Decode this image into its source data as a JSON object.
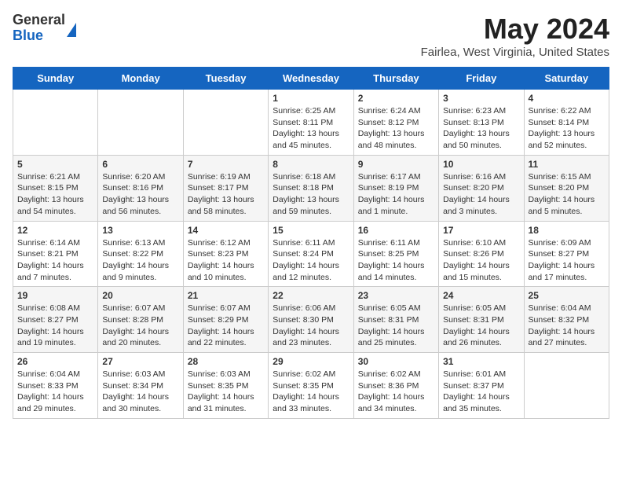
{
  "header": {
    "logo_general": "General",
    "logo_blue": "Blue",
    "title": "May 2024",
    "location": "Fairlea, West Virginia, United States"
  },
  "days_of_week": [
    "Sunday",
    "Monday",
    "Tuesday",
    "Wednesday",
    "Thursday",
    "Friday",
    "Saturday"
  ],
  "weeks": [
    [
      {
        "day": null
      },
      {
        "day": null
      },
      {
        "day": null
      },
      {
        "day": "1",
        "sunrise": "6:25 AM",
        "sunset": "8:11 PM",
        "daylight": "13 hours and 45 minutes."
      },
      {
        "day": "2",
        "sunrise": "6:24 AM",
        "sunset": "8:12 PM",
        "daylight": "13 hours and 48 minutes."
      },
      {
        "day": "3",
        "sunrise": "6:23 AM",
        "sunset": "8:13 PM",
        "daylight": "13 hours and 50 minutes."
      },
      {
        "day": "4",
        "sunrise": "6:22 AM",
        "sunset": "8:14 PM",
        "daylight": "13 hours and 52 minutes."
      }
    ],
    [
      {
        "day": "5",
        "sunrise": "6:21 AM",
        "sunset": "8:15 PM",
        "daylight": "13 hours and 54 minutes."
      },
      {
        "day": "6",
        "sunrise": "6:20 AM",
        "sunset": "8:16 PM",
        "daylight": "13 hours and 56 minutes."
      },
      {
        "day": "7",
        "sunrise": "6:19 AM",
        "sunset": "8:17 PM",
        "daylight": "13 hours and 58 minutes."
      },
      {
        "day": "8",
        "sunrise": "6:18 AM",
        "sunset": "8:18 PM",
        "daylight": "13 hours and 59 minutes."
      },
      {
        "day": "9",
        "sunrise": "6:17 AM",
        "sunset": "8:19 PM",
        "daylight": "14 hours and 1 minute."
      },
      {
        "day": "10",
        "sunrise": "6:16 AM",
        "sunset": "8:20 PM",
        "daylight": "14 hours and 3 minutes."
      },
      {
        "day": "11",
        "sunrise": "6:15 AM",
        "sunset": "8:20 PM",
        "daylight": "14 hours and 5 minutes."
      }
    ],
    [
      {
        "day": "12",
        "sunrise": "6:14 AM",
        "sunset": "8:21 PM",
        "daylight": "14 hours and 7 minutes."
      },
      {
        "day": "13",
        "sunrise": "6:13 AM",
        "sunset": "8:22 PM",
        "daylight": "14 hours and 9 minutes."
      },
      {
        "day": "14",
        "sunrise": "6:12 AM",
        "sunset": "8:23 PM",
        "daylight": "14 hours and 10 minutes."
      },
      {
        "day": "15",
        "sunrise": "6:11 AM",
        "sunset": "8:24 PM",
        "daylight": "14 hours and 12 minutes."
      },
      {
        "day": "16",
        "sunrise": "6:11 AM",
        "sunset": "8:25 PM",
        "daylight": "14 hours and 14 minutes."
      },
      {
        "day": "17",
        "sunrise": "6:10 AM",
        "sunset": "8:26 PM",
        "daylight": "14 hours and 15 minutes."
      },
      {
        "day": "18",
        "sunrise": "6:09 AM",
        "sunset": "8:27 PM",
        "daylight": "14 hours and 17 minutes."
      }
    ],
    [
      {
        "day": "19",
        "sunrise": "6:08 AM",
        "sunset": "8:27 PM",
        "daylight": "14 hours and 19 minutes."
      },
      {
        "day": "20",
        "sunrise": "6:07 AM",
        "sunset": "8:28 PM",
        "daylight": "14 hours and 20 minutes."
      },
      {
        "day": "21",
        "sunrise": "6:07 AM",
        "sunset": "8:29 PM",
        "daylight": "14 hours and 22 minutes."
      },
      {
        "day": "22",
        "sunrise": "6:06 AM",
        "sunset": "8:30 PM",
        "daylight": "14 hours and 23 minutes."
      },
      {
        "day": "23",
        "sunrise": "6:05 AM",
        "sunset": "8:31 PM",
        "daylight": "14 hours and 25 minutes."
      },
      {
        "day": "24",
        "sunrise": "6:05 AM",
        "sunset": "8:31 PM",
        "daylight": "14 hours and 26 minutes."
      },
      {
        "day": "25",
        "sunrise": "6:04 AM",
        "sunset": "8:32 PM",
        "daylight": "14 hours and 27 minutes."
      }
    ],
    [
      {
        "day": "26",
        "sunrise": "6:04 AM",
        "sunset": "8:33 PM",
        "daylight": "14 hours and 29 minutes."
      },
      {
        "day": "27",
        "sunrise": "6:03 AM",
        "sunset": "8:34 PM",
        "daylight": "14 hours and 30 minutes."
      },
      {
        "day": "28",
        "sunrise": "6:03 AM",
        "sunset": "8:35 PM",
        "daylight": "14 hours and 31 minutes."
      },
      {
        "day": "29",
        "sunrise": "6:02 AM",
        "sunset": "8:35 PM",
        "daylight": "14 hours and 33 minutes."
      },
      {
        "day": "30",
        "sunrise": "6:02 AM",
        "sunset": "8:36 PM",
        "daylight": "14 hours and 34 minutes."
      },
      {
        "day": "31",
        "sunrise": "6:01 AM",
        "sunset": "8:37 PM",
        "daylight": "14 hours and 35 minutes."
      },
      {
        "day": null
      }
    ]
  ]
}
